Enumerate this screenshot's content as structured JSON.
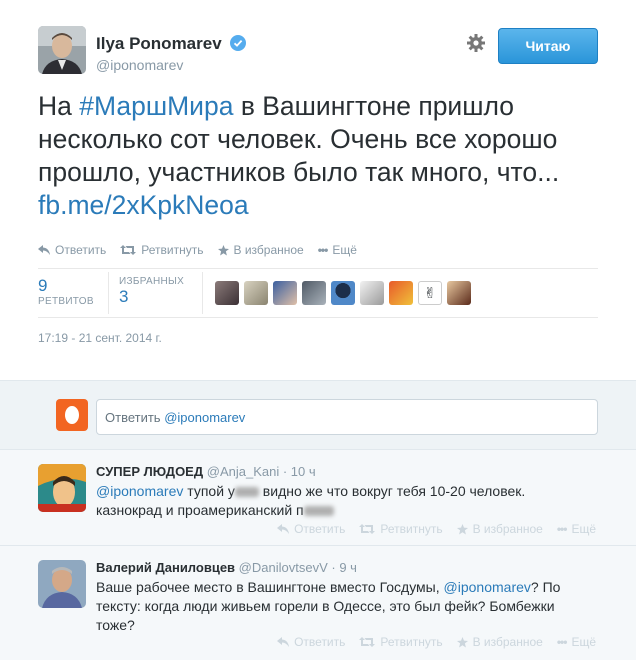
{
  "author": {
    "name": "Ilya Ponomarev",
    "handle": "@iponomarev"
  },
  "follow_label": "Читаю",
  "tweet": {
    "prefix": "На ",
    "hashtag": "#МаршМира",
    "body": " в Вашингтоне пришло несколько сот человек. Очень все хорошо прошло, участников было так много, что... ",
    "link": "fb.me/2xKpkNeoa"
  },
  "actions": {
    "reply": "Ответить",
    "retweet": "Ретвитнуть",
    "favorite": "В избранное",
    "more": "Ещё"
  },
  "stats": {
    "retweets_count": "9",
    "retweets_label": "РЕТВИТОВ",
    "favorites_label": "ИЗБРАННЫХ",
    "favorites_count": "3"
  },
  "timestamp": "17:19 - 21 сент. 2014 г.",
  "reply_box": {
    "prefix": "Ответить ",
    "mention": "@iponomarev"
  },
  "replies": [
    {
      "name": "СУПЕР ЛЮДОЕД",
      "handle": "@Anja_Kani",
      "time": "· 10 ч",
      "mention": "@iponomarev",
      "text_a": " тупой у",
      "text_b": " видно же что вокруг тебя 10-20 человек.",
      "text_c": "казнокрад и проамериканский п"
    },
    {
      "name": "Валерий Даниловцев",
      "handle": "@DanilovtsevV",
      "time": "· 9 ч",
      "text_a": "Ваше рабочее место в Вашингтоне вместо Госдумы, ",
      "mention": "@iponomarev",
      "text_b": "? По тексту: когда люди живьем горели в Одессе, это был фейк? Бомбежки тоже?"
    }
  ],
  "colors": {
    "link": "#2b7bb9",
    "muted": "#8899a6",
    "follow_button": "#2a95d9"
  }
}
